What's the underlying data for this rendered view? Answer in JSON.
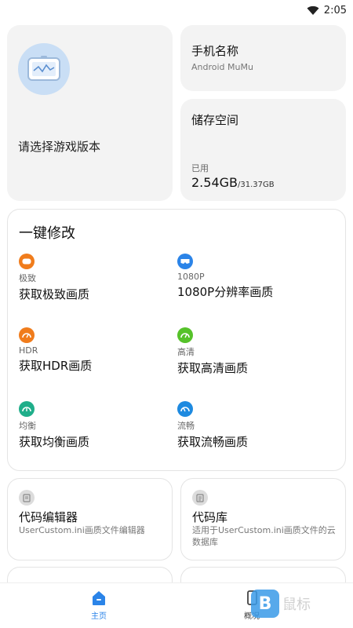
{
  "status": {
    "time": "2:05"
  },
  "colors": {
    "accent": "#2b84e8",
    "orange": "#f07c1c",
    "green": "#56c22a",
    "teal": "#1fae8a",
    "blue": "#1e8ae0"
  },
  "device_card": {
    "icon": "tablet-chart-icon",
    "label": "请选择游戏版本"
  },
  "phone_card": {
    "title": "手机名称",
    "value": "Android MuMu"
  },
  "storage_card": {
    "title": "储存空间",
    "used_label": "已用",
    "used": "2.54GB",
    "total": "/31.37GB"
  },
  "quick_modify": {
    "title": "一键修改",
    "items": [
      {
        "icon": "controller-icon",
        "color": "#f07c1c",
        "tag": "极致",
        "title": "获取极致画质"
      },
      {
        "icon": "vr-icon",
        "color": "#2b84e8",
        "tag": "1080P",
        "title": "1080P分辨率画质"
      },
      {
        "icon": "speed-icon",
        "color": "#f07c1c",
        "tag": "HDR",
        "title": "获取HDR画质"
      },
      {
        "icon": "speed-icon",
        "color": "#56c22a",
        "tag": "高清",
        "title": "获取高清画质"
      },
      {
        "icon": "speed-icon",
        "color": "#1fae8a",
        "tag": "均衡",
        "title": "获取均衡画质"
      },
      {
        "icon": "speed-icon",
        "color": "#1e8ae0",
        "tag": "流畅",
        "title": "获取流畅画质"
      }
    ]
  },
  "tools": [
    {
      "icon": "document-icon",
      "title": "代码编辑器",
      "desc": "UserCustom.ini画质文件编辑器"
    },
    {
      "icon": "database-icon",
      "title": "代码库",
      "desc": "适用于UserCustom.ini画质文件的云数据库"
    }
  ],
  "nav": {
    "home": "主页",
    "overview": "概况",
    "watermark": "鼠标"
  }
}
